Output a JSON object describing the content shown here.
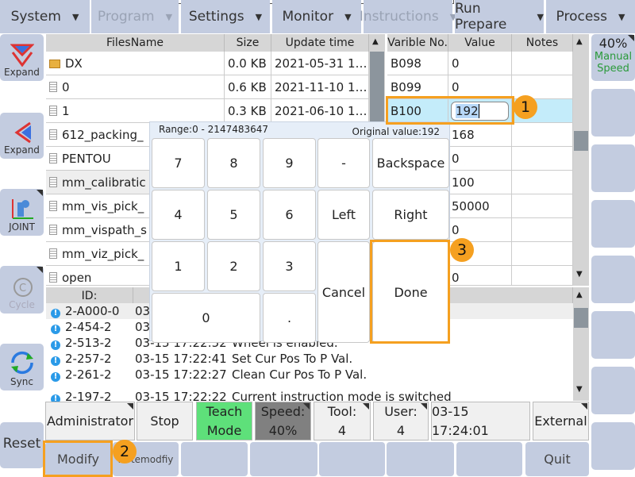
{
  "menu": [
    {
      "label": "System",
      "enabled": true
    },
    {
      "label": "Program",
      "enabled": false
    },
    {
      "label": "Settings",
      "enabled": true
    },
    {
      "label": "Monitor",
      "enabled": true
    },
    {
      "label": "Instructions",
      "enabled": false
    },
    {
      "label": "Run Prepare",
      "enabled": true
    },
    {
      "label": "Process",
      "enabled": true
    }
  ],
  "left": {
    "expand1": "Expand",
    "expand2": "Expand",
    "joint": "JOINT",
    "cycle": "Cycle",
    "sync": "Sync",
    "reset": "Reset"
  },
  "right": {
    "speed": "40%",
    "mode1": "Manual",
    "mode2": "Speed"
  },
  "files": {
    "headers": [
      "FilesName",
      "Size",
      "Update time"
    ],
    "rows": [
      {
        "name": "DX",
        "size": "0.0 KB",
        "time": "2021-05-31 1…",
        "type": "folder"
      },
      {
        "name": "0",
        "size": "0.6 KB",
        "time": "2021-11-10 1…",
        "type": "file"
      },
      {
        "name": "1",
        "size": "0.3 KB",
        "time": "2021-06-10 1…",
        "type": "file"
      },
      {
        "name": "612_packing_",
        "type": "file"
      },
      {
        "name": "PENTOU",
        "type": "file"
      },
      {
        "name": "mm_calibratic",
        "type": "file"
      },
      {
        "name": "mm_vis_pick_",
        "type": "file"
      },
      {
        "name": "mm_vispath_s",
        "type": "file"
      },
      {
        "name": "mm_viz_pick_",
        "type": "file"
      },
      {
        "name": "open",
        "type": "file"
      }
    ]
  },
  "vars": {
    "headers": [
      "Varible No.",
      "Value",
      "Notes"
    ],
    "rows": [
      {
        "no": "B098",
        "value": "0"
      },
      {
        "no": "B099",
        "value": "0"
      },
      {
        "no": "B100",
        "value": "192"
      },
      {
        "no": "",
        "value": "168"
      },
      {
        "no": "",
        "value": "0"
      },
      {
        "no": "",
        "value": "100"
      },
      {
        "no": "",
        "value": "50000"
      },
      {
        "no": "",
        "value": "0"
      },
      {
        "no": "",
        "value": ""
      },
      {
        "no": "",
        "value": "0"
      }
    ]
  },
  "keypad": {
    "range": "Range:0 - 2147483647",
    "original": "Original value:192",
    "keys": [
      "7",
      "8",
      "9",
      "-",
      "Backspace",
      "4",
      "5",
      "6",
      "Left",
      "Right",
      "1",
      "2",
      "3",
      "Cancel",
      "Done",
      "0",
      "."
    ]
  },
  "log": {
    "header": "ID:",
    "rows": [
      {
        "id": "2-A000-0",
        "time": "03",
        "msg": ""
      },
      {
        "id": "2-454-2",
        "time": "03",
        "msg": ""
      },
      {
        "id": "2-513-2",
        "time": "03-15 17:22:52",
        "msg": "Wheel is enabled."
      },
      {
        "id": "2-257-2",
        "time": "03-15 17:22:41",
        "msg": "Set Cur Pos To P Val."
      },
      {
        "id": "2-261-2",
        "time": "03-15 17:22:27",
        "msg": "Clean Cur Pos To P Val."
      },
      {
        "id": "2-197-2",
        "time": "03-15 17:22:22",
        "msg": "Current instruction mode is switched"
      }
    ]
  },
  "status": {
    "user": "Administrator",
    "stop": "Stop",
    "mode1": "Teach",
    "mode2": "Mode",
    "speed1": "Speed:",
    "speed2": "40%",
    "tool1": "Tool:",
    "tool2": "4",
    "usr1": "User:",
    "usr2": "4",
    "time": "03-15 17:24:01",
    "external": "External"
  },
  "bottom": {
    "modify": "Modify",
    "notemodify": "Notemodfiy",
    "quit": "Quit"
  },
  "badges": [
    "1",
    "2",
    "3"
  ],
  "colors": {
    "accent": "#f5a020",
    "teach": "#5ee07a",
    "speed": "#808080",
    "panel": "#c3cce0"
  }
}
